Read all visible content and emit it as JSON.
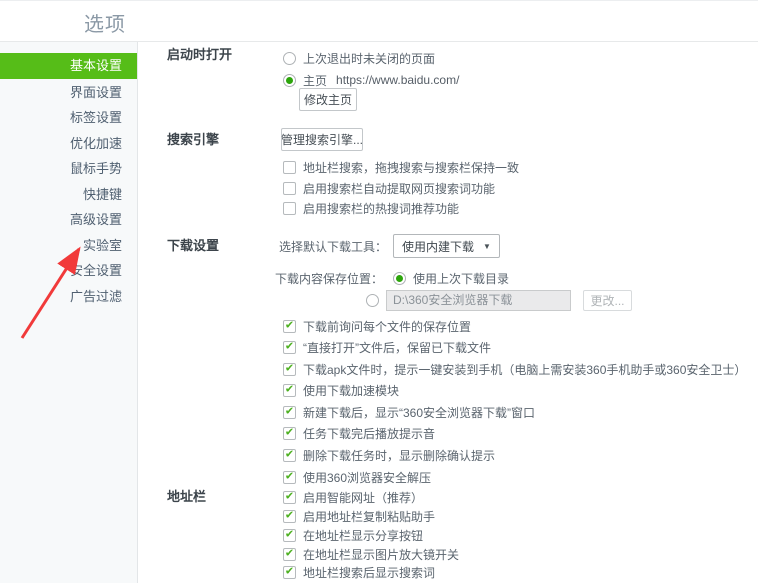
{
  "page": {
    "title": "选项"
  },
  "sidebar": {
    "items": [
      {
        "label": "基本设置",
        "selected": true
      },
      {
        "label": "界面设置",
        "selected": false
      },
      {
        "label": "标签设置",
        "selected": false
      },
      {
        "label": "优化加速",
        "selected": false
      },
      {
        "label": "鼠标手势",
        "selected": false
      },
      {
        "label": "快捷键",
        "selected": false
      },
      {
        "label": "高级设置",
        "selected": false
      },
      {
        "label": "实验室",
        "selected": false
      },
      {
        "label": "安全设置",
        "selected": false
      },
      {
        "label": "广告过滤",
        "selected": false
      }
    ]
  },
  "sections": {
    "startup": {
      "label": "启动时打开",
      "radio_last_session": "上次退出时未关闭的页面",
      "radio_last_session_selected": false,
      "radio_homepage": "主页",
      "radio_homepage_selected": true,
      "homepage_url": "https://www.baidu.com/",
      "modify_homepage_button": "修改主页"
    },
    "search": {
      "label": "搜索引擎",
      "manage_button": "管理搜索引擎...",
      "checkboxes": [
        {
          "label": "地址栏搜索，拖拽搜索与搜索栏保持一致",
          "checked": false
        },
        {
          "label": "启用搜索栏自动提取网页搜索词功能",
          "checked": false
        },
        {
          "label": "启用搜索栏的热搜词推荐功能",
          "checked": false
        }
      ]
    },
    "download": {
      "label": "下载设置",
      "default_tool_label": "选择默认下载工具：",
      "default_tool_value": "使用内建下载",
      "save_location_label": "下载内容保存位置：",
      "radio_last_dir": "使用上次下载目录",
      "radio_last_dir_selected": true,
      "custom_dir_value": "D:\\360安全浏览器下载",
      "change_button": "更改...",
      "checkboxes": [
        {
          "label": "下载前询问每个文件的保存位置",
          "checked": true
        },
        {
          "label": "“直接打开”文件后，保留已下载文件",
          "checked": true
        },
        {
          "label": "下载apk文件时，提示一键安装到手机（电脑上需安装360手机助手或360安全卫士）",
          "checked": true
        },
        {
          "label": "使用下载加速模块",
          "checked": true
        },
        {
          "label": "新建下载后，显示“360安全浏览器下载”窗口",
          "checked": true
        },
        {
          "label": "任务下载完后播放提示音",
          "checked": true
        },
        {
          "label": "删除下载任务时，显示删除确认提示",
          "checked": true
        },
        {
          "label": "使用360浏览器安全解压",
          "checked": true
        }
      ]
    },
    "addressbar": {
      "label": "地址栏",
      "checkboxes": [
        {
          "label": "启用智能网址（推荐）",
          "checked": true
        },
        {
          "label": "启用地址栏复制粘贴助手",
          "checked": true
        },
        {
          "label": "在地址栏显示分享按钮",
          "checked": true
        },
        {
          "label": "在地址栏显示图片放大镜开关",
          "checked": true
        },
        {
          "label": "地址栏搜索后显示搜索词",
          "checked": true
        }
      ]
    }
  },
  "icons": {
    "checkmark": "✔",
    "dropdown_caret": "▼"
  },
  "colors": {
    "accent_green": "#56bd18",
    "check_green": "#4cb01f",
    "radio_green": "#2da50c",
    "arrow_red": "#f13a3a",
    "sidebar_bg": "#f7f9fa"
  }
}
